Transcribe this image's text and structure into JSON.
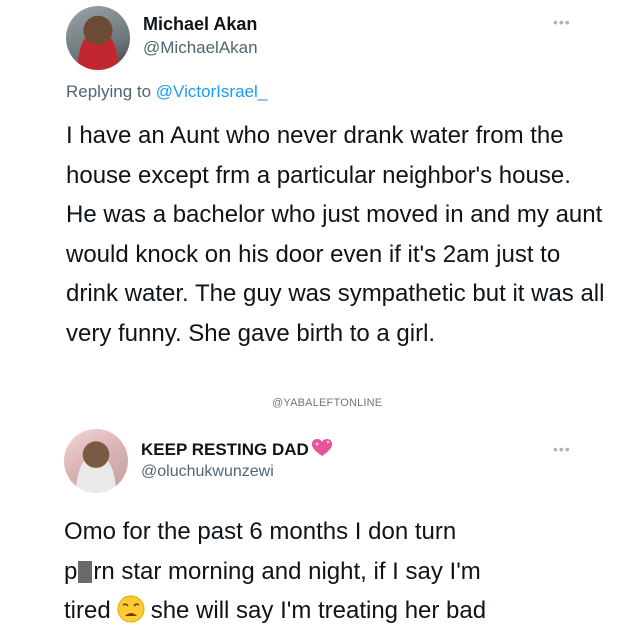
{
  "tweet1": {
    "display_name": "Michael Akan",
    "handle": "@MichaelAkan",
    "more_icon": "more-dots-icon",
    "more_glyph": "•••",
    "replying_prefix": "Replying to ",
    "replying_to": "@VictorIsrael_",
    "body": "I have an Aunt who never drank water from the house except frm a particular neighbor's house. He was a bachelor who just moved in and my aunt would knock on his door even if it's 2am just to drink water. The guy was sympathetic but it was all very funny. She gave birth to a girl."
  },
  "watermark": "@YABALEFTONLINE",
  "tweet2": {
    "display_name": "KEEP RESTING DAD",
    "name_emoji_icon": "sparkling-heart-icon",
    "handle": "@oluchukwunzewi",
    "more_icon": "more-dots-icon",
    "more_glyph": "•••",
    "body_line1": "Omo for the past 6 months I don turn",
    "body_line2_pre": "p",
    "body_line2_post": "rn star morning and night, if I say I'm",
    "body_line3_pre": "tired",
    "body_emoji_icon": "weary-face-icon",
    "body_line3_post": "she will say I'm treating her bad"
  }
}
